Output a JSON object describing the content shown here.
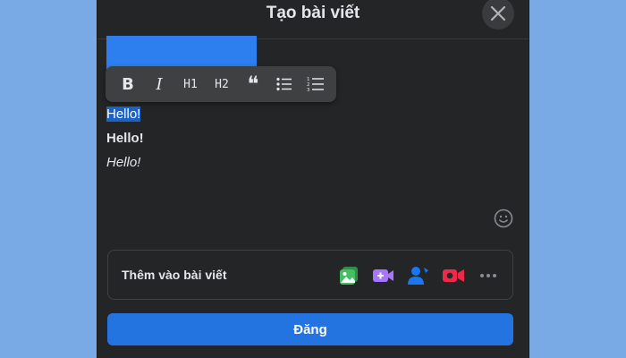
{
  "dialog": {
    "title": "Tạo bài viết"
  },
  "toolbar": {
    "bold_label": "B",
    "italic_label": "I",
    "h1_label": "H1",
    "h2_label": "H2",
    "quote_label": "❝",
    "icons": [
      "bold-icon",
      "italic-icon",
      "heading-1-icon",
      "heading-2-icon",
      "quote-icon",
      "bulleted-list-icon",
      "numbered-list-icon"
    ]
  },
  "editor": {
    "lines": [
      {
        "text": "Hello!",
        "style": "selected"
      },
      {
        "text": "Hello!",
        "style": "bold"
      },
      {
        "text": "Hello!",
        "style": "italic"
      }
    ]
  },
  "add_to_post": {
    "label": "Thêm vào bài viết",
    "icons": [
      "photo-video-icon",
      "live-video-icon",
      "tag-people-icon",
      "video-camera-icon",
      "more-icon"
    ]
  },
  "post_button": {
    "label": "Đăng"
  },
  "colors": {
    "background": "#7aaae6",
    "modal": "#242526",
    "accent": "#2374e1",
    "photo": "#45bd62",
    "live": "#a974ff",
    "tag": "#1877f2",
    "camera": "#f02849"
  }
}
